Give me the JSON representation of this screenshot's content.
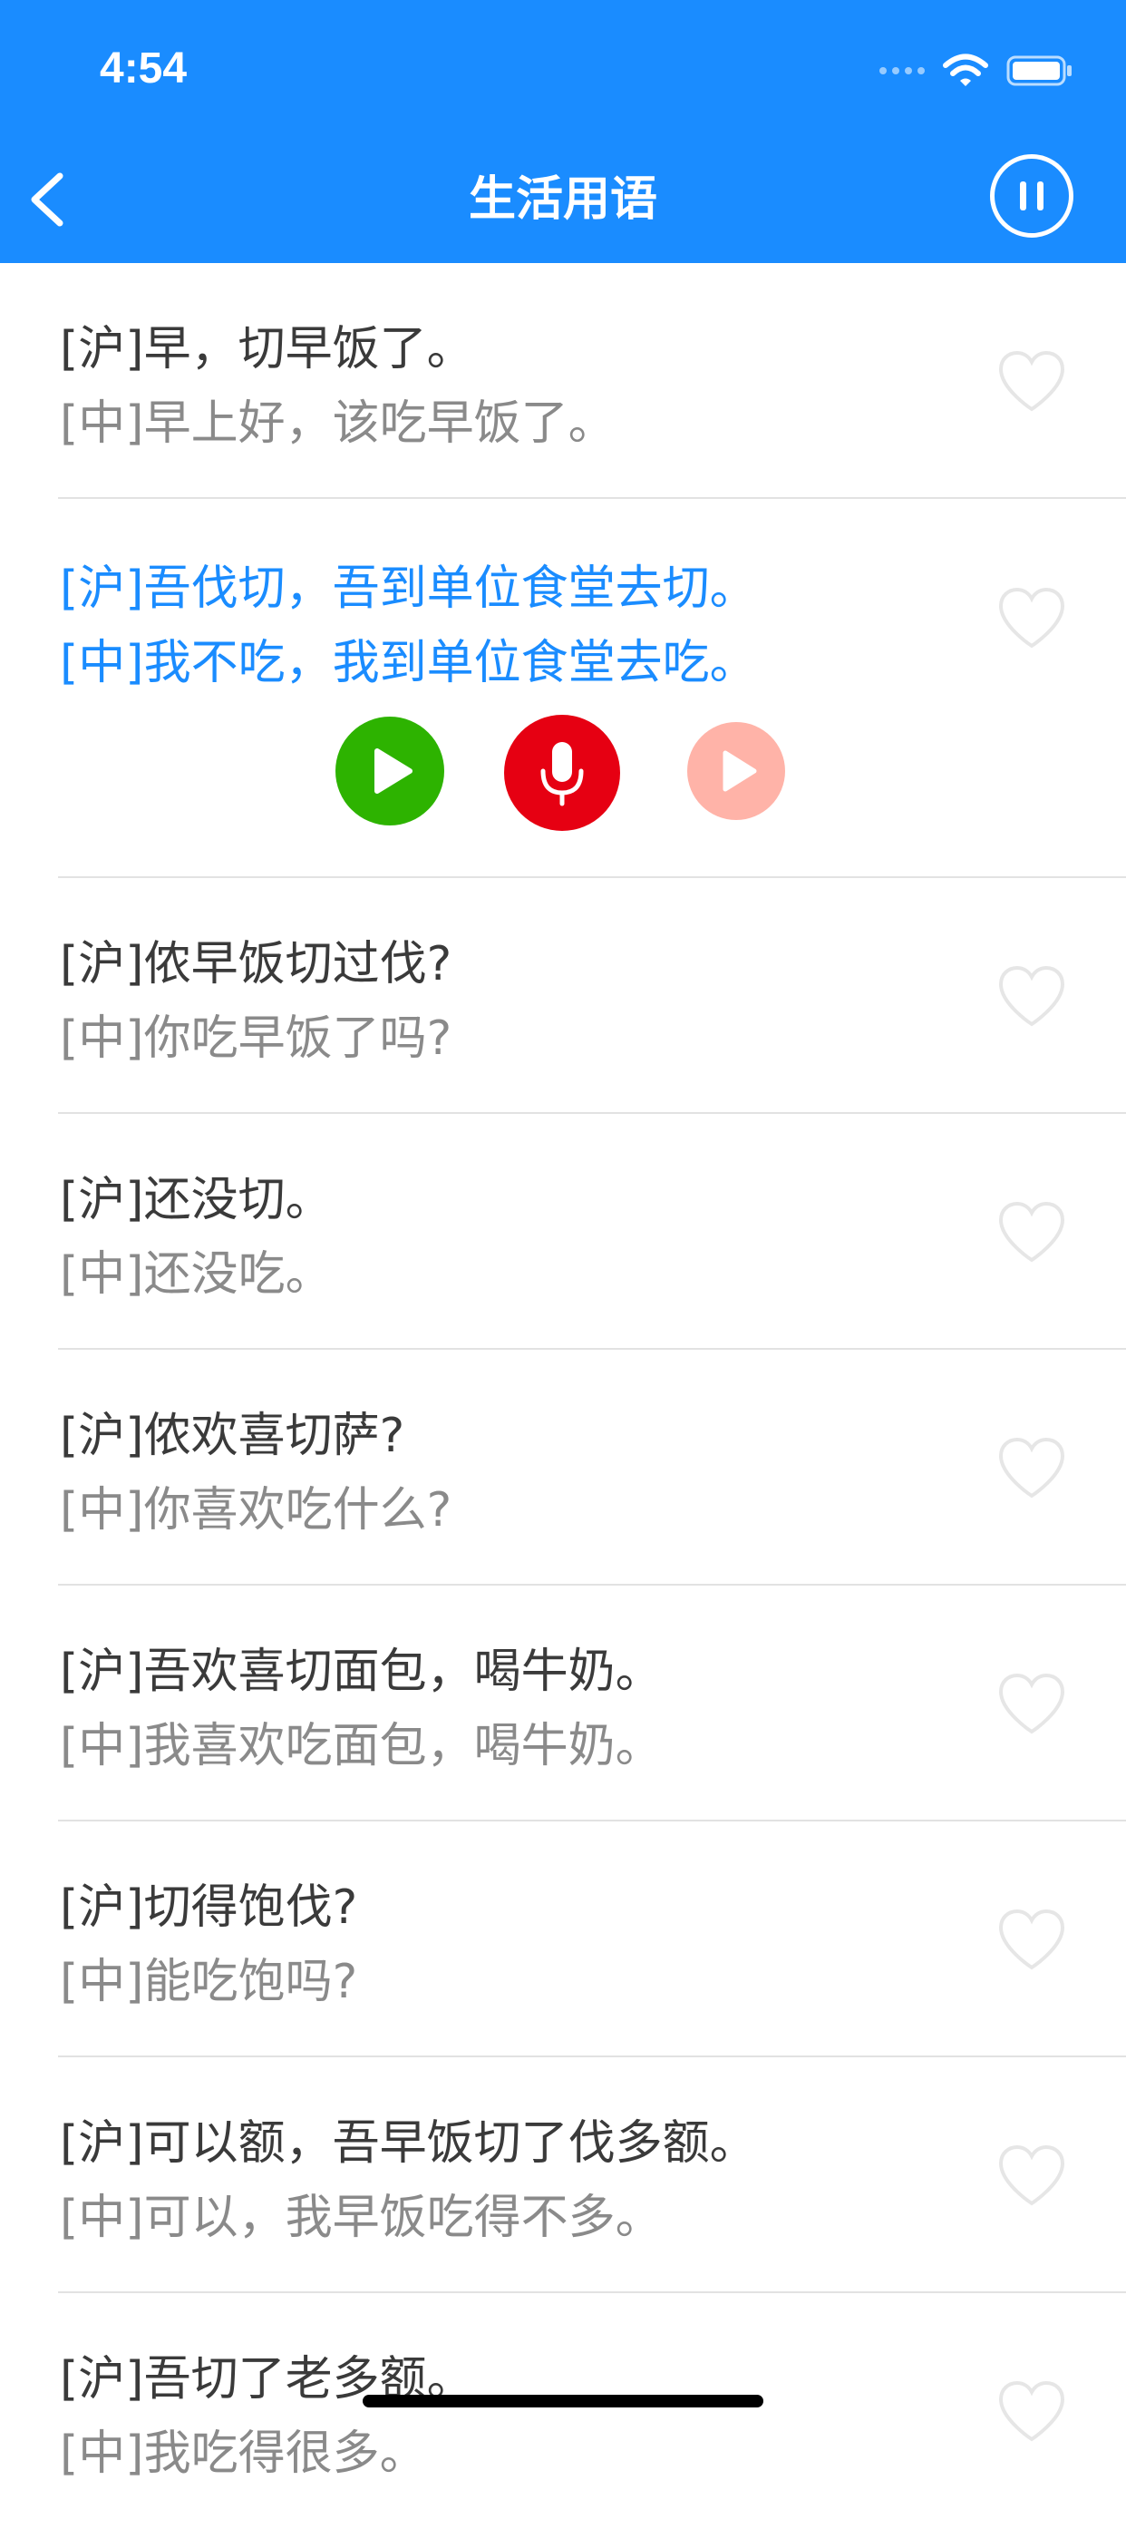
{
  "status_bar": {
    "time": "4:54"
  },
  "nav": {
    "title": "生活用语"
  },
  "colors": {
    "header": "#1a8cff",
    "highlight": "#1a8cff",
    "play": "#2db300",
    "record": "#e60012",
    "playback": "#ffb3a8"
  },
  "icons": {
    "back": "chevron-left-icon",
    "pause": "pause-circle-icon",
    "favorite": "heart-outline-icon"
  },
  "phrases": [
    {
      "hu": "[沪]早，切早饭了。",
      "zh": "[中]早上好，该吃早饭了。"
    },
    {
      "hu": "[沪]吾伐切，吾到单位食堂去切。",
      "zh": "[中]我不吃，我到单位食堂去吃。"
    },
    {
      "hu": "[沪]侬早饭切过伐?",
      "zh": "[中]你吃早饭了吗?"
    },
    {
      "hu": "[沪]还没切。",
      "zh": "[中]还没吃。"
    },
    {
      "hu": "[沪]侬欢喜切萨?",
      "zh": "[中]你喜欢吃什么?"
    },
    {
      "hu": "[沪]吾欢喜切面包，喝牛奶。",
      "zh": "[中]我喜欢吃面包，喝牛奶。"
    },
    {
      "hu": "[沪]切得饱伐?",
      "zh": "[中]能吃饱吗?"
    },
    {
      "hu": "[沪]可以额，吾早饭切了伐多额。",
      "zh": "[中]可以，我早饭吃得不多。"
    },
    {
      "hu": "[沪]吾切了老多额。",
      "zh": "[中]我吃得很多。"
    }
  ]
}
